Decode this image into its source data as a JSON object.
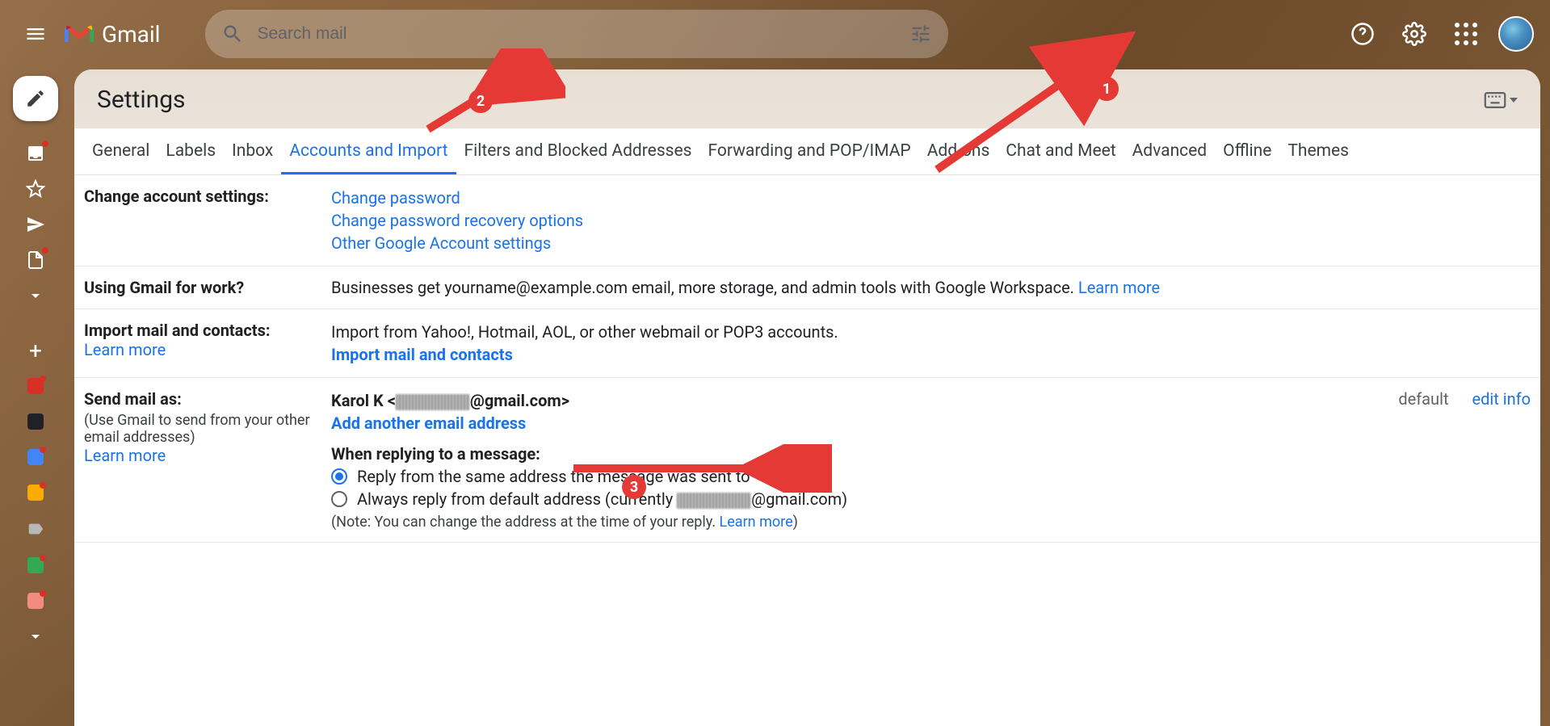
{
  "header": {
    "app_name": "Gmail",
    "search_placeholder": "Search mail"
  },
  "main": {
    "title": "Settings",
    "tabs": [
      "General",
      "Labels",
      "Inbox",
      "Accounts and Import",
      "Filters and Blocked Addresses",
      "Forwarding and POP/IMAP",
      "Add-ons",
      "Chat and Meet",
      "Advanced",
      "Offline",
      "Themes"
    ],
    "active_tab_index": 3
  },
  "sections": {
    "change_account": {
      "label": "Change account settings:",
      "links": [
        "Change password",
        "Change password recovery options",
        "Other Google Account settings"
      ]
    },
    "work": {
      "label": "Using Gmail for work?",
      "text": "Businesses get yourname@example.com email, more storage, and admin tools with Google Workspace. ",
      "link": "Learn more"
    },
    "import": {
      "label": "Import mail and contacts:",
      "learn_more": "Learn more",
      "text": "Import from Yahoo!, Hotmail, AOL, or other webmail or POP3 accounts.",
      "action": "Import mail and contacts"
    },
    "send_as": {
      "label": "Send mail as:",
      "sub": "(Use Gmail to send from your other email addresses)",
      "learn_more": "Learn more",
      "identity_name": "Karol K",
      "identity_suffix": "@gmail.com>",
      "default_text": "default",
      "edit_link": "edit info",
      "add_link": "Add another email address",
      "reply_heading": "When replying to a message:",
      "reply_opt1": "Reply from the same address the message was sent to",
      "reply_opt2_prefix": "Always reply from default address (currently ",
      "reply_opt2_suffix": "@gmail.com)",
      "note_prefix": "(Note: You can change the address at the time of your reply. ",
      "note_link": "Learn more",
      "note_suffix": ")"
    }
  },
  "annotations": {
    "badge1": "1",
    "badge2": "2",
    "badge3": "3"
  }
}
